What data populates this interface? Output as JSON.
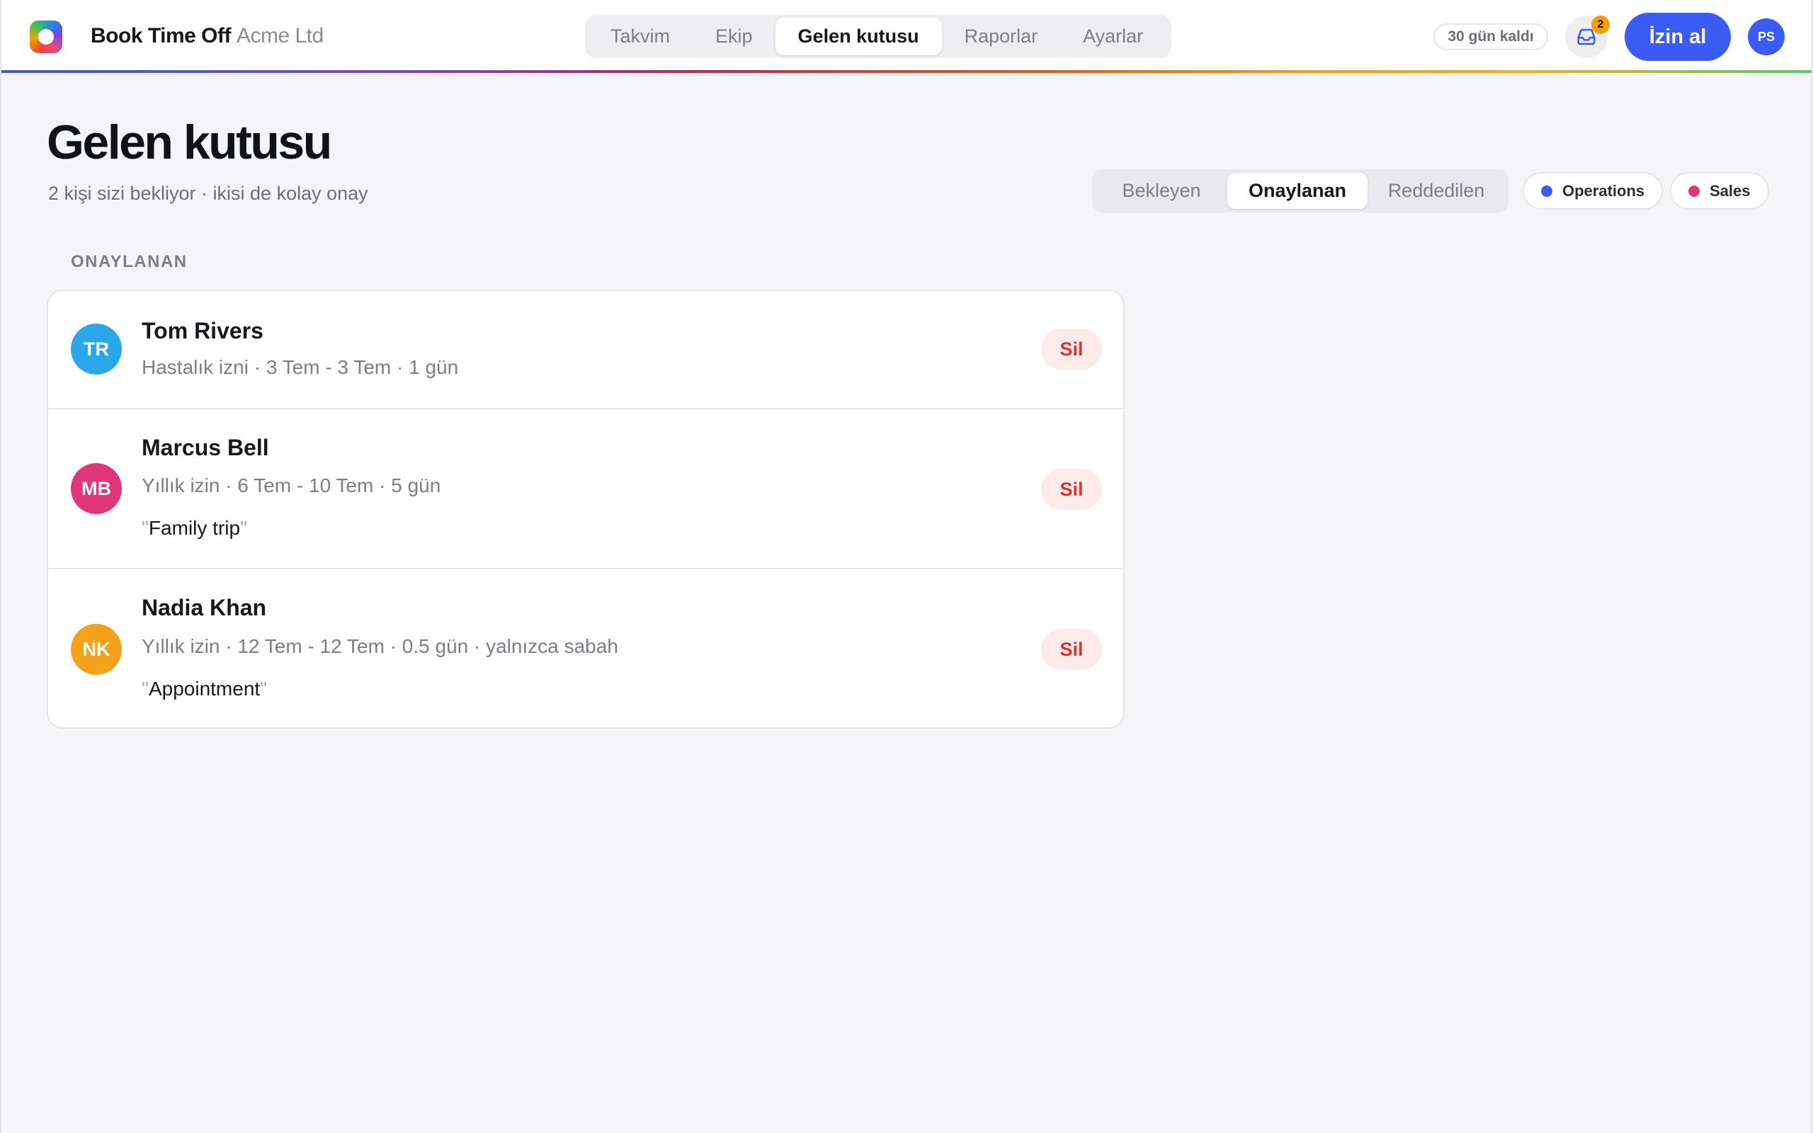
{
  "header": {
    "app_name": "Book Time Off",
    "org_name": "Acme Ltd",
    "logo_icon": "app-logo",
    "nav_tabs": [
      {
        "label": "Takvim",
        "active": false
      },
      {
        "label": "Ekip",
        "active": false
      },
      {
        "label": "Gelen kutusu",
        "active": true
      },
      {
        "label": "Raporlar",
        "active": false
      },
      {
        "label": "Ayarlar",
        "active": false
      }
    ],
    "trial_label": "30 gün kaldı",
    "inbox_icon": "inbox-icon",
    "inbox_count": "2",
    "cta_label": "İzin al",
    "user_initials": "PS"
  },
  "page": {
    "title": "Gelen kutusu",
    "subtitle": "2 kişi sizi bekliyor · ikisi de kolay onay",
    "filter_tabs": [
      {
        "label": "Bekleyen",
        "active": false
      },
      {
        "label": "Onaylanan",
        "active": true
      },
      {
        "label": "Reddedilen",
        "active": false
      }
    ],
    "teams": [
      {
        "label": "Operations",
        "color": "#3b5bf5"
      },
      {
        "label": "Sales",
        "color": "#e0357a"
      }
    ],
    "section_label": "ONAYLANAN"
  },
  "requests": [
    {
      "initials": "TR",
      "avatar_color": "#2aa7e8",
      "name": "Tom Rivers",
      "type": "Hastalık izni",
      "start": "3 Tem",
      "end": "3 Tem",
      "duration": "1 gün",
      "extra": "",
      "note": "",
      "action": "Sil"
    },
    {
      "initials": "MB",
      "avatar_color": "#e0357a",
      "name": "Marcus Bell",
      "type": "Yıllık izin",
      "start": "6 Tem",
      "end": "10 Tem",
      "duration": "5 gün",
      "extra": "",
      "note": "Family trip",
      "action": "Sil"
    },
    {
      "initials": "NK",
      "avatar_color": "#f4a11c",
      "name": "Nadia Khan",
      "type": "Yıllık izin",
      "start": "12 Tem",
      "end": "12 Tem",
      "duration": "0.5 gün",
      "extra": "yalnızca sabah",
      "note": "Appointment",
      "action": "Sil"
    }
  ]
}
